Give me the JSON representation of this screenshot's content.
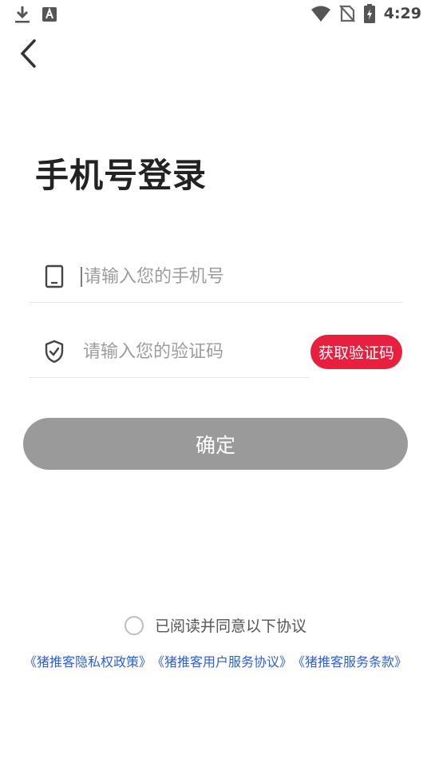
{
  "status_bar": {
    "time": "4:29",
    "left_icons": [
      "download-icon",
      "text-a-icon"
    ],
    "right_icons": [
      "wifi-icon",
      "no-sim-icon",
      "battery-charging-icon"
    ]
  },
  "nav": {
    "back_icon": "chevron-left-icon"
  },
  "title": "手机号登录",
  "phone_field": {
    "icon": "phone-icon",
    "placeholder": "请输入您的手机号",
    "value": ""
  },
  "code_field": {
    "icon": "shield-check-icon",
    "placeholder": "请输入您的验证码",
    "value": ""
  },
  "get_code_label": "获取验证码",
  "confirm_label": "确定",
  "agreement": {
    "checked": false,
    "text": "已阅读并同意以下协议",
    "links": [
      "《猪推客隐私权政策》",
      "《猪推客用户服务协议》",
      "《猪推客服务条款》"
    ]
  },
  "colors": {
    "accent": "#e8203f",
    "button_disabled": "#9a9a9a",
    "link": "#2d5fd6"
  }
}
